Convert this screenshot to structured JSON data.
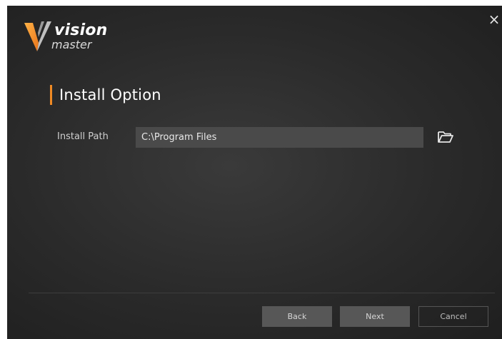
{
  "window": {
    "close_glyph": "×"
  },
  "logo": {
    "mark_letter": "V",
    "line1": "vision",
    "line2": "master"
  },
  "section": {
    "title": "Install Option"
  },
  "install_path": {
    "label": "Install Path",
    "value": "C:\\Program Files"
  },
  "buttons": {
    "back": "Back",
    "next": "Next",
    "cancel": "Cancel"
  },
  "icons": {
    "close": "close-icon",
    "browse": "folder-open-icon"
  },
  "colors": {
    "accent": "#f08a24",
    "background": "#2a2a2a",
    "input_bg": "#4a4a4a",
    "button_bg": "#575757"
  }
}
